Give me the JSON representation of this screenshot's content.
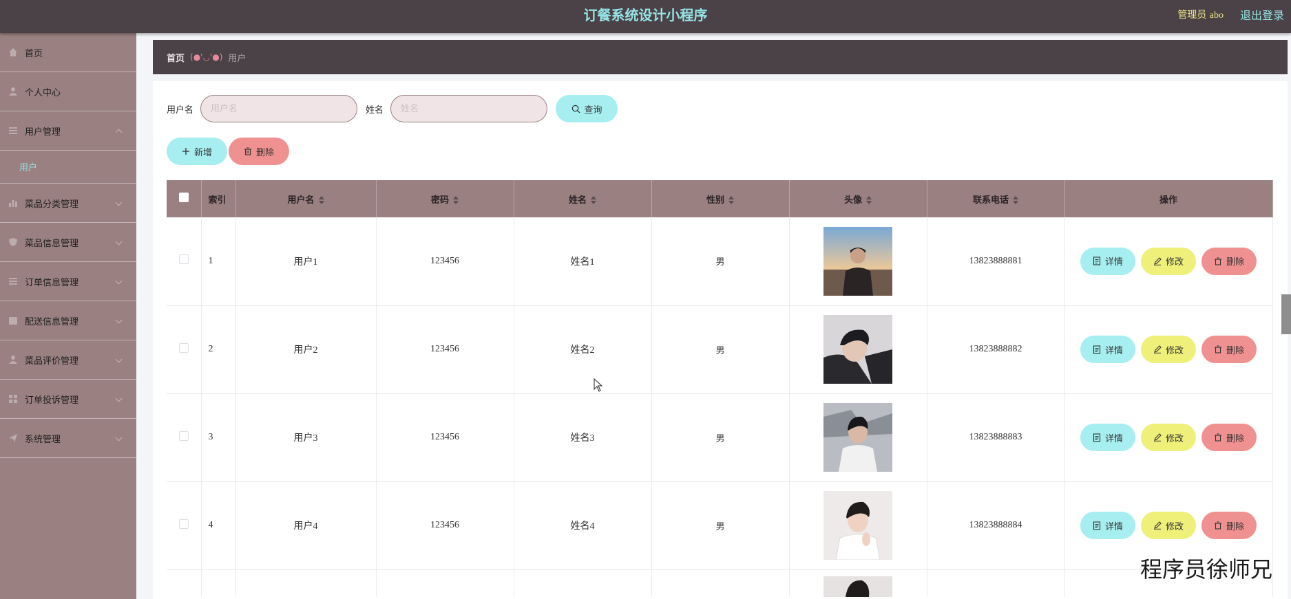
{
  "header": {
    "app_title": "订餐系统设计小程序",
    "admin_label": "管理员",
    "admin_name": "abo",
    "logout_label": "退出登录"
  },
  "sidebar": {
    "items": [
      {
        "label": "首页",
        "icon": "home-icon"
      },
      {
        "label": "个人中心",
        "icon": "user-icon"
      },
      {
        "label": "用户管理",
        "icon": "list-icon",
        "expanded": true,
        "children": [
          {
            "label": "用户"
          }
        ]
      },
      {
        "label": "菜品分类管理",
        "icon": "chart-icon"
      },
      {
        "label": "菜品信息管理",
        "icon": "shield-icon"
      },
      {
        "label": "订单信息管理",
        "icon": "list-icon"
      },
      {
        "label": "配送信息管理",
        "icon": "box-icon"
      },
      {
        "label": "菜品评价管理",
        "icon": "user-icon"
      },
      {
        "label": "订单投诉管理",
        "icon": "grid-icon"
      },
      {
        "label": "系统管理",
        "icon": "send-icon"
      }
    ]
  },
  "breadcrumb": {
    "home": "首页",
    "separator": "(●'◡'●)",
    "current": "用户"
  },
  "search": {
    "username_label": "用户名",
    "username_placeholder": "用户名",
    "name_label": "姓名",
    "name_placeholder": "姓名",
    "query_button": "查询"
  },
  "actions": {
    "add_button": "新增",
    "delete_button": "删除"
  },
  "table": {
    "columns": [
      "索引",
      "用户名",
      "密码",
      "姓名",
      "性别",
      "头像",
      "联系电话",
      "操作"
    ],
    "rows": [
      {
        "index": "1",
        "username": "用户1",
        "password": "123456",
        "name": "姓名1",
        "gender": "男",
        "phone": "13823888881"
      },
      {
        "index": "2",
        "username": "用户2",
        "password": "123456",
        "name": "姓名2",
        "gender": "男",
        "phone": "13823888882"
      },
      {
        "index": "3",
        "username": "用户3",
        "password": "123456",
        "name": "姓名3",
        "gender": "男",
        "phone": "13823888883"
      },
      {
        "index": "4",
        "username": "用户4",
        "password": "123456",
        "name": "姓名4",
        "gender": "男",
        "phone": "13823888884"
      }
    ],
    "row_actions": {
      "detail": "详情",
      "edit": "修改",
      "delete": "删除"
    }
  },
  "watermark": "程序员徐师兄",
  "colors": {
    "header_bg": "#4a4246",
    "sidebar_bg": "#9a8080",
    "accent_cyan": "#a6eef0",
    "accent_red": "#f09191",
    "accent_yellow": "#eef07a",
    "title_color": "#96e4e6"
  }
}
